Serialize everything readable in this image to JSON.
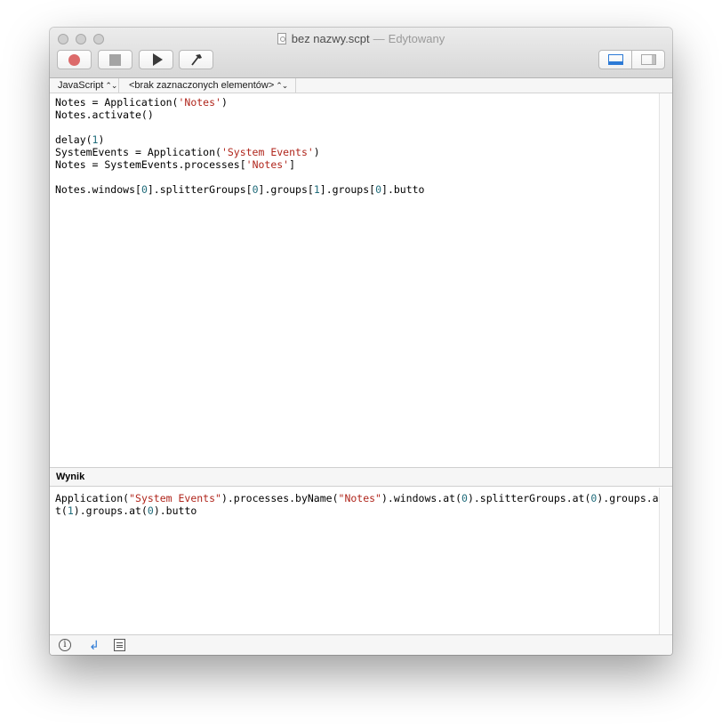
{
  "window": {
    "title": "bez nazwy.scpt",
    "separator": "—",
    "edited_label": "Edytowany"
  },
  "toolbar": {
    "buttons": [
      "record-icon",
      "stop-icon",
      "run-icon",
      "compile-icon"
    ],
    "view_toggle": [
      "bottom-pane-icon",
      "side-pane-icon"
    ]
  },
  "navbar": {
    "language": "JavaScript",
    "elements": "<brak zaznaczonych elementów>"
  },
  "editor": {
    "lines": [
      [
        [
          "t",
          "Notes = Application("
        ],
        [
          "s",
          "'Notes'"
        ],
        [
          "t",
          ")"
        ]
      ],
      [
        [
          "t",
          "Notes.activate()"
        ]
      ],
      [
        [
          "t",
          ""
        ]
      ],
      [
        [
          "t",
          "delay("
        ],
        [
          "n",
          "1"
        ],
        [
          "t",
          ")"
        ]
      ],
      [
        [
          "t",
          "SystemEvents = Application("
        ],
        [
          "s",
          "'System Events'"
        ],
        [
          "t",
          ")"
        ]
      ],
      [
        [
          "t",
          "Notes = SystemEvents.processes["
        ],
        [
          "s",
          "'Notes'"
        ],
        [
          "t",
          "]"
        ]
      ],
      [
        [
          "t",
          ""
        ]
      ],
      [
        [
          "t",
          "Notes.windows["
        ],
        [
          "n",
          "0"
        ],
        [
          "t",
          "].splitterGroups["
        ],
        [
          "n",
          "0"
        ],
        [
          "t",
          "].groups["
        ],
        [
          "n",
          "1"
        ],
        [
          "t",
          "].groups["
        ],
        [
          "n",
          "0"
        ],
        [
          "t",
          "].butto"
        ]
      ]
    ]
  },
  "result": {
    "header": "Wynik",
    "tokens": [
      [
        "t",
        "Application("
      ],
      [
        "s",
        "\"System Events\""
      ],
      [
        "t",
        ").processes.byName("
      ],
      [
        "s",
        "\"Notes\""
      ],
      [
        "t",
        ").windows.at("
      ],
      [
        "n",
        "0"
      ],
      [
        "t",
        ").splitterGroups.at("
      ],
      [
        "n",
        "0"
      ],
      [
        "t",
        ").groups.at("
      ],
      [
        "n",
        "1"
      ],
      [
        "t",
        ").groups.at("
      ],
      [
        "n",
        "0"
      ],
      [
        "t",
        ").butto"
      ]
    ]
  },
  "colors": {
    "string": "#b0261c",
    "number": "#1f6b7a",
    "accent": "#2c7ad6",
    "record": "#dc6a6a"
  },
  "bottom_bar": {
    "icons": [
      "info-icon",
      "return-icon",
      "list-icon"
    ]
  }
}
